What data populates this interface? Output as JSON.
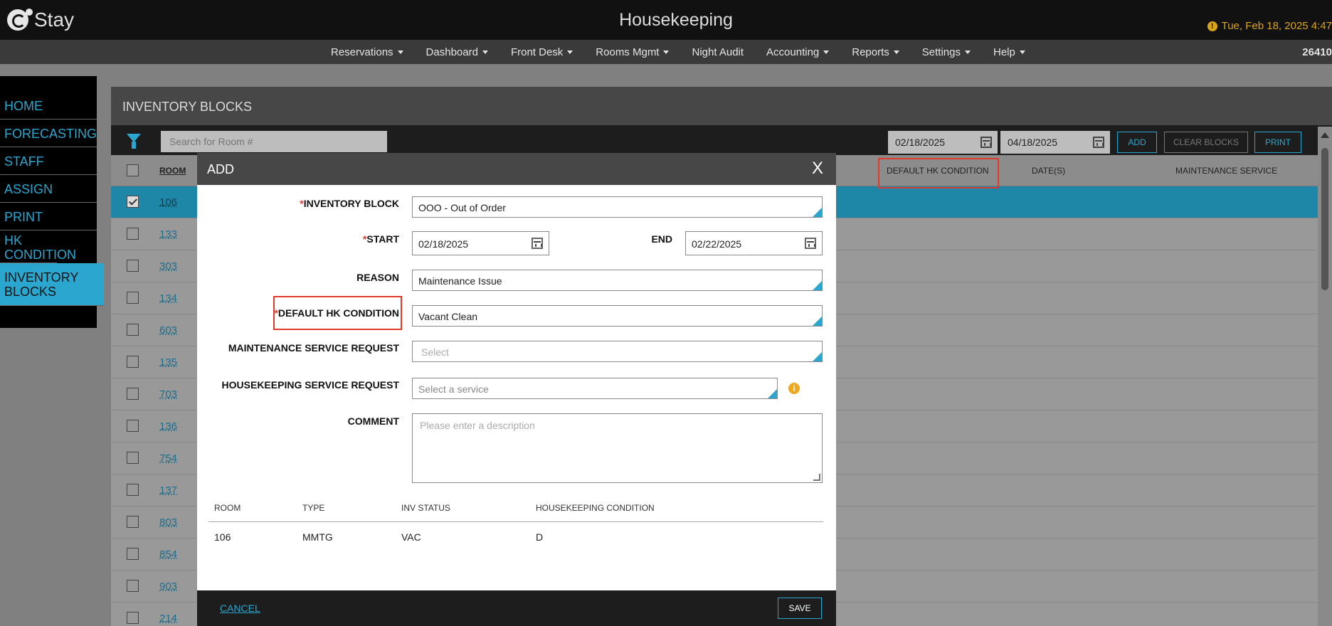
{
  "header": {
    "logo_text": "Stay",
    "app_title": "Housekeeping",
    "datetime": "Tue, Feb 18, 2025 4:47",
    "warn_icon": "!"
  },
  "nav": {
    "items": [
      {
        "label": "Reservations",
        "dropdown": true
      },
      {
        "label": "Dashboard",
        "dropdown": true
      },
      {
        "label": "Front Desk",
        "dropdown": true
      },
      {
        "label": "Rooms Mgmt",
        "dropdown": true
      },
      {
        "label": "Night Audit",
        "dropdown": false
      },
      {
        "label": "Accounting",
        "dropdown": true
      },
      {
        "label": "Reports",
        "dropdown": true
      },
      {
        "label": "Settings",
        "dropdown": true
      },
      {
        "label": "Help",
        "dropdown": true
      }
    ],
    "code": "26410"
  },
  "sidebar": {
    "items": [
      {
        "label": "HOME",
        "active": false
      },
      {
        "label": "FORECASTING",
        "active": false
      },
      {
        "label": "STAFF",
        "active": false
      },
      {
        "label": "ASSIGN",
        "active": false
      },
      {
        "label": "PRINT",
        "active": false
      },
      {
        "label": "HK CONDITION",
        "active": false
      },
      {
        "label": "INVENTORY BLOCKS",
        "active": true
      }
    ]
  },
  "main": {
    "title": "INVENTORY BLOCKS",
    "search_placeholder": "Search for Room #",
    "date_from": "02/18/2025",
    "date_to": "04/18/2025",
    "add_label": "ADD",
    "clear_label": "CLEAR BLOCKS",
    "print_label": "PRINT",
    "columns": {
      "room": "ROOM",
      "default_hk": "DEFAULT HK CONDITION",
      "dates": "DATE(S)",
      "maintenance": "MAINTENANCE SERVICE"
    },
    "rooms": [
      "106",
      "133",
      "303",
      "134",
      "603",
      "135",
      "703",
      "136",
      "754",
      "137",
      "803",
      "854",
      "903",
      "214"
    ]
  },
  "modal": {
    "title": "ADD",
    "close": "X",
    "labels": {
      "inventory_block": "INVENTORY BLOCK",
      "start": "START",
      "end": "END",
      "reason": "REASON",
      "default_hk": "DEFAULT HK CONDITION",
      "maint_req": "MAINTENANCE SERVICE REQUEST",
      "hk_req": "HOUSEKEEPING SERVICE REQUEST",
      "comment": "COMMENT"
    },
    "required_mark": "*",
    "values": {
      "inventory_block": "OOO - Out of Order",
      "start": "02/18/2025",
      "end": "02/22/2025",
      "reason": "Maintenance Issue",
      "default_hk": "Vacant Clean",
      "maint_req_placeholder": "Select",
      "hk_req_placeholder": "Select a service",
      "comment_placeholder": "Please enter a description"
    },
    "info_icon": "i",
    "table": {
      "headers": [
        "ROOM",
        "TYPE",
        "INV STATUS",
        "HOUSEKEEPING CONDITION"
      ],
      "rows": [
        [
          "106",
          "MMTG",
          "VAC",
          "D"
        ]
      ]
    },
    "cancel_label": "CANCEL",
    "save_label": "SAVE"
  }
}
